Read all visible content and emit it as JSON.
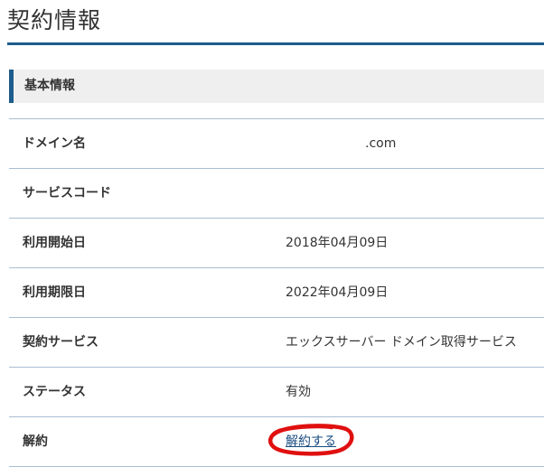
{
  "page": {
    "title": "契約情報"
  },
  "section": {
    "title": "基本情報"
  },
  "rows": [
    {
      "label": "ドメイン名",
      "value": ".com"
    },
    {
      "label": "サービスコード",
      "value": ""
    },
    {
      "label": "利用開始日",
      "value": "2018年04月09日"
    },
    {
      "label": "利用期限日",
      "value": "2022年04月09日"
    },
    {
      "label": "契約サービス",
      "value": "エックスサーバー ドメイン取得サービス"
    },
    {
      "label": "ステータス",
      "value": "有効"
    },
    {
      "label": "解約",
      "value": "解約する"
    }
  ],
  "colors": {
    "accent": "#1d5c8c",
    "row_border": "#a9bfd2",
    "header_bg": "#efefef",
    "link": "#1a4d82",
    "annotation_circle": "#e01010"
  }
}
